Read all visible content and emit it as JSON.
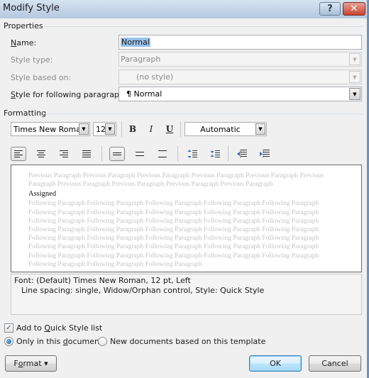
{
  "window": {
    "title": "Modify Style",
    "help_glyph": "?",
    "close_glyph": "✕"
  },
  "properties": {
    "group_label": "Properties",
    "name": {
      "label_key": "N",
      "label_rest": "ame:",
      "value": "Normal"
    },
    "style_type": {
      "label": "Style type:",
      "value": "Paragraph"
    },
    "style_based_on": {
      "label": "Style based on:",
      "value": "(no style)"
    },
    "following": {
      "label_key": "S",
      "label_rest": "tyle for following paragraph:",
      "value": "¶ Normal"
    }
  },
  "formatting": {
    "group_label": "Formatting",
    "font": "Times New Roman",
    "size": "12",
    "bold": "B",
    "italic": "I",
    "underline": "U",
    "color": "Automatic",
    "align_left_selected": true,
    "single_spacing_selected": true
  },
  "preview": {
    "previous_text": "Previous Paragraph Previous Paragraph Previous Paragraph Previous Paragraph Previous Paragraph Previous Paragraph Previous Paragraph Previous Paragraph Previous Paragraph Previous Paragraph",
    "sample_text": "Assigned",
    "following_text": "Following Paragraph Following Paragraph Following Paragraph Following Paragraph Following Paragraph Following Paragraph Following Paragraph Following Paragraph Following Paragraph Following Paragraph Following Paragraph Following Paragraph Following Paragraph Following Paragraph Following Paragraph Following Paragraph Following Paragraph Following Paragraph Following Paragraph Following Paragraph Following Paragraph Following Paragraph Following Paragraph Following Paragraph Following Paragraph Following Paragraph Following Paragraph Following Paragraph Following Paragraph Following Paragraph Following Paragraph Following Paragraph Following Paragraph Following Paragraph Following Paragraph Following Paragraph Following Paragraph Following Paragraph"
  },
  "description": {
    "line1": "Font: (Default) Times New Roman, 12 pt, Left",
    "line2": "Line spacing:  single, Widow/Orphan control, Style: Quick Style"
  },
  "options": {
    "add_quick_style": {
      "pre": "Add to ",
      "key": "Q",
      "post": "uick Style list",
      "checked": true
    },
    "only_this_doc": {
      "pre": "Only in this ",
      "key": "d",
      "post": "ocument",
      "selected": true
    },
    "new_docs": {
      "label": "New documents based on this template",
      "selected": false
    }
  },
  "buttons": {
    "format_pre": "F",
    "format_key": "o",
    "format_post": "rmat ▾",
    "ok": "OK",
    "cancel": "Cancel"
  }
}
